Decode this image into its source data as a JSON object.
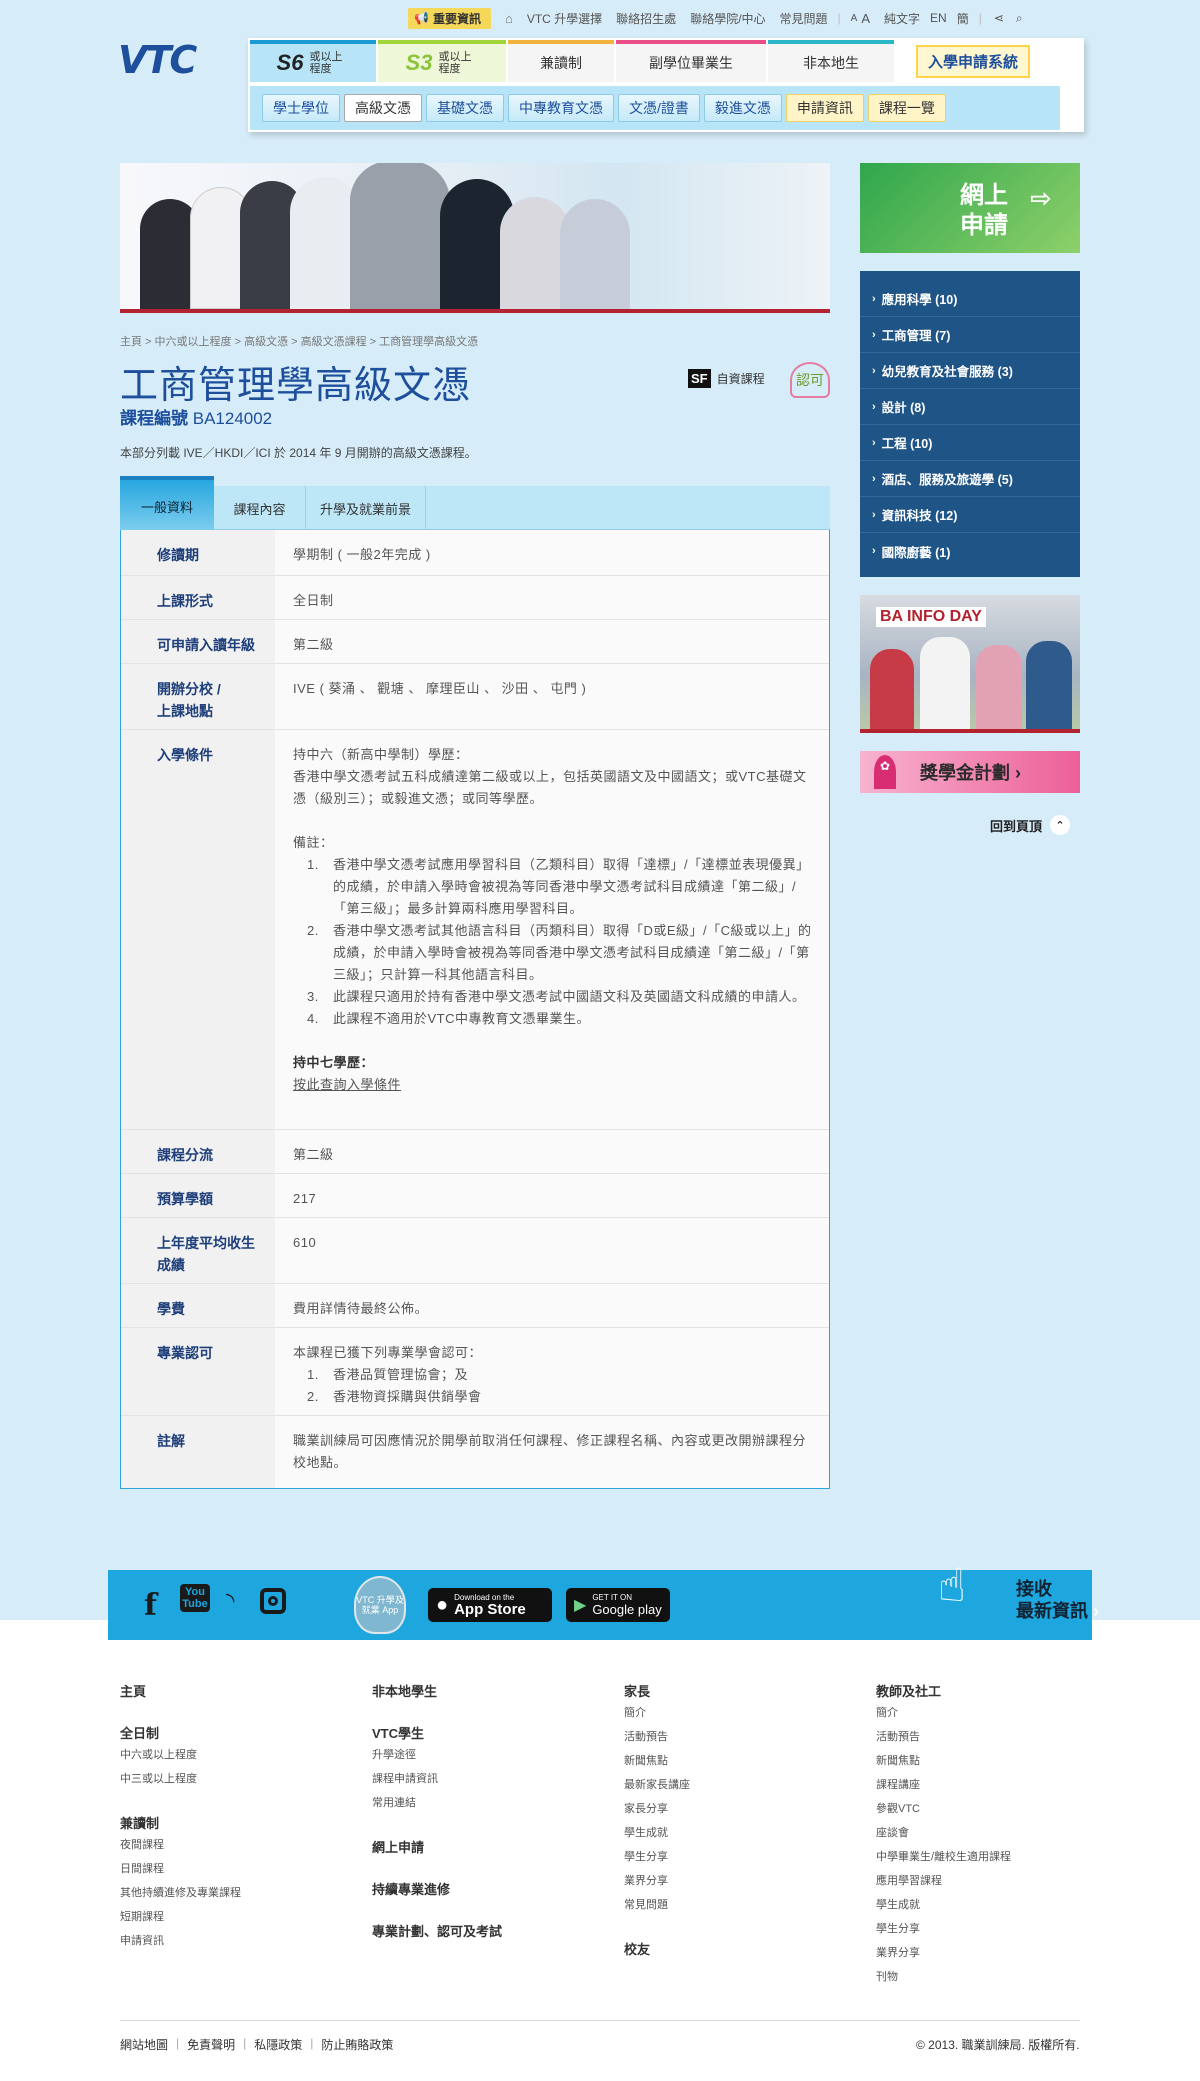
{
  "top_util": {
    "news": "重要資訊",
    "links": [
      "VTC 升學選擇",
      "聯絡招生處",
      "聯絡學院/中心",
      "常見問題"
    ],
    "font_small": "A",
    "font_large": "A",
    "plain_text": "純文字",
    "lang_en": "EN",
    "lang_sc": "簡"
  },
  "logo": {
    "text": "VTC"
  },
  "nav": {
    "s6_big": "S6",
    "s6_small": "或以上程度",
    "s3_big": "S3",
    "s3_small": "或以上程度",
    "parttime": "兼讀制",
    "associate": "副學位畢業生",
    "nonlocal": "非本地生",
    "apply_system": "入學申請系統",
    "sub": [
      "學士學位",
      "高級文憑",
      "基礎文憑",
      "中專教育文憑",
      "文憑/證書",
      "毅進文憑",
      "申請資訊",
      "課程一覽"
    ]
  },
  "breadcrumb": "主頁 > 中六或以上程度 > 高級文憑 > 高級文憑課程 > 工商管理學高級文憑",
  "title": "工商管理學高級文憑",
  "code_label": "課程編號",
  "code_value": "BA124002",
  "sf_badge": "SF",
  "sf_text": "自資課程",
  "sf_logo": "認可",
  "intro": "本部分列載 IVE／HKDI／ICI 於 2014 年 9 月開辦的高級文憑課程。",
  "tabs": [
    "一般資料",
    "課程內容",
    "升學及就業前景"
  ],
  "table": {
    "study_mode_label": "修讀期",
    "study_mode": "學期制 ( 一般2年完成 )",
    "class_mode_label": "上課形式",
    "class_mode": "全日制",
    "entry_year_label": "可申請入讀年級",
    "entry_year": "第二級",
    "campus_label": "開辦分校 /\n上課地點",
    "campus": "IVE ( 葵涌 、 觀塘 、 摩理臣山 、 沙田 、 屯門 )",
    "req_label": "入學條件",
    "req_intro": "持中六（新高中學制）學歷：",
    "req_body": "香港中學文憑考試五科成績達第二級或以上，包括英國語文及中國語文；或VTC基礎文憑（級別三）；或毅進文憑；或同等學歷。",
    "req_notes_title": "備註：",
    "req_notes": [
      {
        "n": "1.",
        "t": "香港中學文憑考試應用學習科目（乙類科目）取得「達標」/「達標並表現優異」的成績，於申請入學時會被視為等同香港中學文憑考試科目成績達「第二級」/「第三級」；最多計算兩科應用學習科目。"
      },
      {
        "n": "2.",
        "t": "香港中學文憑考試其他語言科目（丙類科目）取得「D或E級」/「C級或以上」的成績，於申請入學時會被視為等同香港中學文憑考試科目成績達「第二級」/「第三級」；只計算一科其他語言科目。"
      },
      {
        "n": "3.",
        "t": "此課程只適用於持有香港中學文憑考試中國語文科及英國語文科成績的申請人。"
      },
      {
        "n": "4.",
        "t": "此課程不適用於VTC中專教育文憑畢業生。"
      }
    ],
    "f7_title": "持中七學歷：",
    "f7_link": "按此查詢入學條件",
    "stream_label": "課程分流",
    "stream": "第二級",
    "quota_label": "預算學額",
    "quota": "217",
    "avg_label": "上年度平均收生\n成績",
    "avg": "610",
    "fee_label": "學費",
    "fee": "費用詳情待最終公佈。",
    "recog_label": "專業認可",
    "recog_intro": "本課程已獲下列專業學會認可：",
    "recog_items": [
      {
        "n": "1.",
        "t": "香港品質管理協會；及"
      },
      {
        "n": "2.",
        "t": "香港物資採購與供銷學會"
      }
    ],
    "note_label": "註解",
    "note": "職業訓練局可因應情況於開學前取消任何課程、修正課程名稱、內容或更改開辦課程分校地點。"
  },
  "sidebar": {
    "apply_line1": "網上",
    "apply_line2": "申請",
    "categories": [
      "應用科學 (10)",
      "工商管理 (7)",
      "幼兒教育及社會服務 (3)",
      "設計 (8)",
      "工程 (10)",
      "酒店、服務及旅遊學 (5)",
      "資訊科技 (12)",
      "國際廚藝 (1)"
    ],
    "info_day": "BA INFO DAY",
    "scholarship": "獎學金計劃 ›",
    "back_top": "回到頁頂"
  },
  "social": {
    "yt": "You\nTube",
    "app_badge": "VTC 升學及就業 App",
    "appstore_small": "Download on the",
    "appstore_big": "App Store",
    "gplay_small": "GET IT ON",
    "gplay_big": "Google play",
    "receive_l1": "接收",
    "receive_l2": "最新資訊"
  },
  "footer": {
    "col1": {
      "home": "主頁",
      "fulltime": "全日制",
      "fulltime_items": [
        "中六或以上程度",
        "中三或以上程度"
      ],
      "parttime": "兼讀制",
      "parttime_items": [
        "夜間課程",
        "日間課程",
        "其他持續進修及專業課程",
        "短期課程",
        "申請資訊"
      ]
    },
    "col2": {
      "nonlocal": "非本地學生",
      "vtc_students": "VTC學生",
      "vtc_items": [
        "升學途徑",
        "課程申請資訊",
        "常用連結"
      ],
      "online": "網上申請",
      "continuing": "持續專業進修",
      "professional": "專業計劃、認可及考試"
    },
    "col3": {
      "parents": "家長",
      "items": [
        "簡介",
        "活動預告",
        "新聞焦點",
        "最新家長講座",
        "家長分享",
        "學生成就",
        "學生分享",
        "業界分享",
        "常見問題"
      ],
      "alumni": "校友"
    },
    "col4": {
      "teachers": "教師及社工",
      "items": [
        "簡介",
        "活動預告",
        "新聞焦點",
        "課程講座",
        "參觀VTC",
        "座談會",
        "中學畢業生/離校生適用課程",
        "應用學習課程",
        "學生成就",
        "學生分享",
        "業界分享",
        "刊物"
      ]
    },
    "links": [
      "網站地圖",
      "免責聲明",
      "私隱政策",
      "防止賄賂政策"
    ],
    "copyright": "© 2013. 職業訓練局. 版權所有."
  }
}
